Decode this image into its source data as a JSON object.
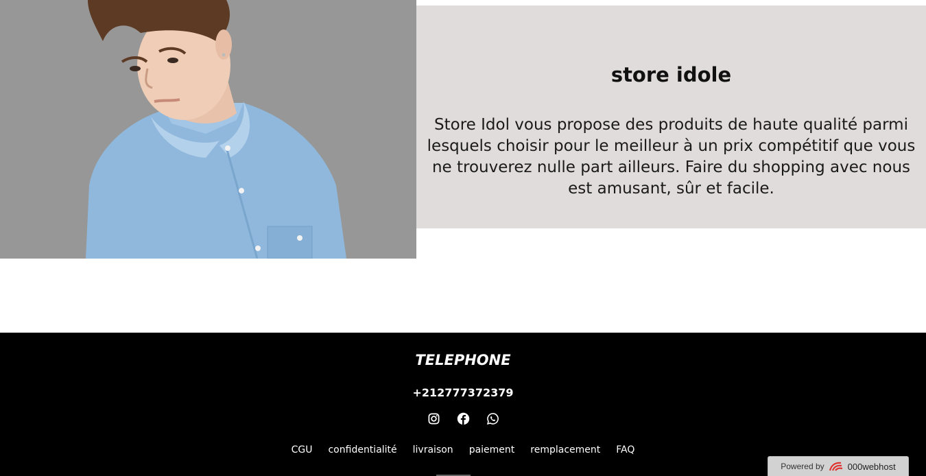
{
  "about": {
    "title": "store idole",
    "text": "Store Idol vous propose des produits de haute qualité parmi lesquels choisir pour le meilleur à un prix compétitif que vous ne trouverez nulle part ailleurs. Faire du shopping avec nous est amusant, sûr et facile."
  },
  "footer": {
    "heading": "TELEPHONE",
    "phone": "+212777372379",
    "social": [
      "instagram-icon",
      "facebook-icon",
      "whatsapp-icon"
    ],
    "links": [
      "CGU",
      "confidentialité",
      "livraison",
      "paiement",
      "remplacement",
      "FAQ"
    ]
  },
  "badge": {
    "prefix": "Powered by",
    "brand": "000webhost"
  },
  "colors": {
    "hero_bg": "#979797",
    "panel_bg": "#e1dcdc",
    "footer_bg": "#000000",
    "shirt": "#8fb8dc"
  }
}
